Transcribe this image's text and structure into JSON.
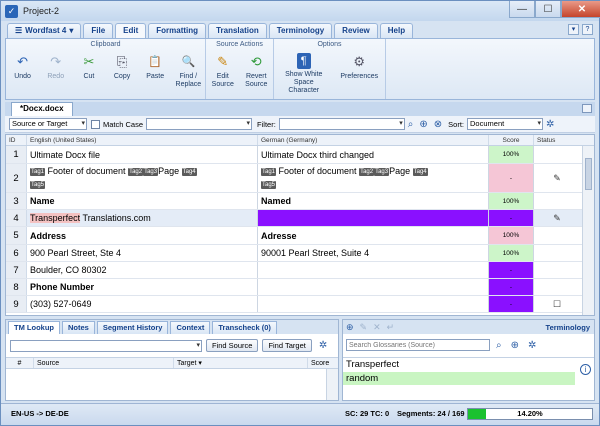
{
  "window": {
    "title": "Project-2",
    "controls": {
      "minimize": "—",
      "maximize": "☐",
      "close": "✕"
    }
  },
  "menu": {
    "app_label": "Wordfast 4",
    "items": [
      "File",
      "Edit",
      "Formatting",
      "Translation",
      "Terminology",
      "Review",
      "Help"
    ],
    "active": "Edit"
  },
  "ribbon": {
    "groups": [
      {
        "title": "Clipboard",
        "buttons": [
          {
            "label": "Undo",
            "icon": "undo-icon",
            "glyph": "↶",
            "disabled": false
          },
          {
            "label": "Redo",
            "icon": "redo-icon",
            "glyph": "↷",
            "disabled": true
          },
          {
            "label": "Cut",
            "icon": "cut-icon",
            "glyph": "✂",
            "disabled": false
          },
          {
            "label": "Copy",
            "icon": "copy-icon",
            "glyph": "⎘",
            "disabled": false
          },
          {
            "label": "Paste",
            "icon": "paste-icon",
            "glyph": "📋",
            "disabled": false
          },
          {
            "label": "Find / Replace",
            "icon": "find-replace-icon",
            "glyph": "🔍",
            "disabled": false
          }
        ]
      },
      {
        "title": "Source Actions",
        "buttons": [
          {
            "label": "Edit Source",
            "icon": "edit-source-icon",
            "glyph": "✎",
            "disabled": false
          },
          {
            "label": "Revert Source",
            "icon": "revert-source-icon",
            "glyph": "⟲",
            "disabled": false
          }
        ]
      },
      {
        "title": "Options",
        "buttons": [
          {
            "label": "Show White Space Character",
            "icon": "pilcrow-icon",
            "glyph": "¶",
            "disabled": false
          },
          {
            "label": "Preferences",
            "icon": "preferences-icon",
            "glyph": "⚙",
            "disabled": false
          }
        ]
      }
    ]
  },
  "document_tab": {
    "label": "*Docx.docx"
  },
  "filterbar": {
    "scope": "Source or Target",
    "match_case": "Match Case",
    "filter_label": "Filter:",
    "sort_label": "Sort:",
    "sort_value": "Document"
  },
  "grid": {
    "headers": {
      "id": "ID",
      "source": "English (United States)",
      "target": "German (Germany)",
      "score": "Score",
      "status": "Status"
    },
    "rows": [
      {
        "id": "1",
        "source": [
          {
            "t": "text",
            "v": "Ultimate Docx file"
          }
        ],
        "target": [
          {
            "t": "text",
            "v": "Ultimate Docx third changed"
          }
        ],
        "score": "100%",
        "score_color": "#cdf5c9",
        "status": "",
        "height": 18
      },
      {
        "id": "2",
        "source": [
          {
            "t": "tag",
            "v": "Tag1"
          },
          {
            "t": "text",
            "v": " Footer of document "
          },
          {
            "t": "tag",
            "v": "Tag2"
          },
          {
            "t": "tag",
            "v": "Tag3"
          },
          {
            "t": "text",
            "v": "Page "
          },
          {
            "t": "tag",
            "v": "Tag4"
          },
          {
            "t": "br"
          },
          {
            "t": "tag",
            "v": "Tag5"
          }
        ],
        "target": [
          {
            "t": "tag",
            "v": "Tag1"
          },
          {
            "t": "text",
            "v": " Footer of document "
          },
          {
            "t": "tag",
            "v": "Tag2"
          },
          {
            "t": "tag",
            "v": "Tag3"
          },
          {
            "t": "text",
            "v": "Page "
          },
          {
            "t": "tag",
            "v": "Tag4"
          },
          {
            "t": "br"
          },
          {
            "t": "tag",
            "v": "Tag5"
          }
        ],
        "score": "-",
        "score_color": "#f5c6d6",
        "status": "✎",
        "height": 29
      },
      {
        "id": "3",
        "source": [
          {
            "t": "bold",
            "v": "Name"
          }
        ],
        "target": [
          {
            "t": "bold",
            "v": "Named"
          }
        ],
        "score": "100%",
        "score_color": "#cdf5c9",
        "status": "",
        "height": 17
      },
      {
        "id": "4",
        "source": [
          {
            "t": "hl",
            "v": "Transperfect"
          },
          {
            "t": "text",
            "v": " Translations.com"
          }
        ],
        "target": [],
        "target_bg": "#8a10ff",
        "score": "-",
        "score_color": "#8a10ff",
        "status": "✎",
        "height": 17,
        "row_bg": "#e4ecf7"
      },
      {
        "id": "5",
        "source": [
          {
            "t": "bold",
            "v": "Address"
          }
        ],
        "target": [
          {
            "t": "bold",
            "v": "Adresse"
          }
        ],
        "score": "100%",
        "score_color": "#f5c6d6",
        "status": "",
        "height": 18
      },
      {
        "id": "6",
        "source": [
          {
            "t": "text",
            "v": "900 Pearl Street, Ste 4"
          }
        ],
        "target": [
          {
            "t": "text",
            "v": "90001 Pearl Street, Suite 4"
          }
        ],
        "score": "100%",
        "score_color": "#cdf5c9",
        "status": "",
        "height": 17
      },
      {
        "id": "7",
        "source": [
          {
            "t": "text",
            "v": "Boulder, CO 80302"
          }
        ],
        "target": [],
        "score": "-",
        "score_color": "#8a10ff",
        "status": "",
        "height": 17
      },
      {
        "id": "8",
        "source": [
          {
            "t": "bold",
            "v": "Phone Number"
          }
        ],
        "target": [],
        "score": "-",
        "score_color": "#8a10ff",
        "status": "",
        "height": 17
      },
      {
        "id": "9",
        "source": [
          {
            "t": "text",
            "v": "(303) 527-0649"
          }
        ],
        "target": [],
        "score": "-",
        "score_color": "#8a10ff",
        "status": "☐",
        "height": 17
      }
    ]
  },
  "tm_pane": {
    "tabs": [
      "TM Lookup",
      "Notes",
      "Segment History",
      "Context",
      "Transcheck (0)"
    ],
    "active": "TM Lookup",
    "find_source": "Find Source",
    "find_target": "Find Target",
    "columns": {
      "num": "#",
      "source": "Source",
      "target": "Target",
      "score": "Score"
    }
  },
  "term_pane": {
    "title": "Terminology",
    "search_placeholder": "Search Glossaries (Source)",
    "entries": [
      "Transperfect",
      "random"
    ]
  },
  "status": {
    "lang_pair": "EN-US -> DE-DE",
    "sc_tc": "SC: 29 TC: 0",
    "segments": "Segments: 24 / 169",
    "progress_text": "14.20%",
    "progress_value": 0.142
  }
}
